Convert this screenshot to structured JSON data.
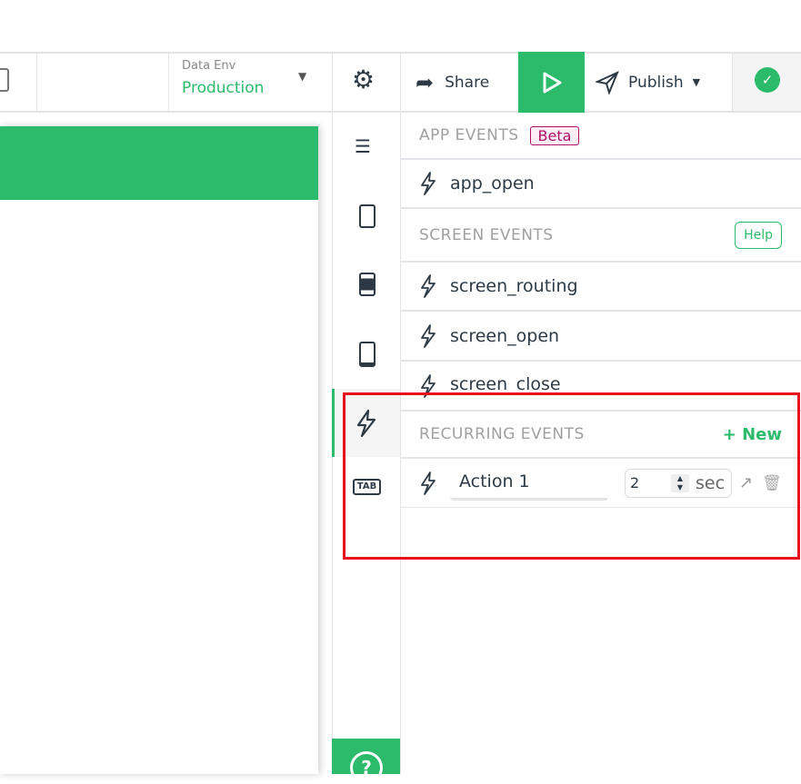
{
  "toolbar": {
    "data_env_label": "Data Env",
    "data_env_value": "Production",
    "share": "Share",
    "publish": "Publish"
  },
  "panel": {
    "app_events": {
      "title": "APP EVENTS",
      "badge": "Beta",
      "items": [
        "app_open"
      ]
    },
    "screen_events": {
      "title": "SCREEN EVENTS",
      "help": "Help",
      "items": [
        "screen_routing",
        "screen_open",
        "screen_close"
      ]
    },
    "recurring_events": {
      "title": "RECURRING EVENTS",
      "new": "+ New",
      "action_name": "Action 1",
      "interval": "2",
      "unit": "sec"
    }
  },
  "rail": {
    "tab_label": "TAB",
    "help": "?"
  },
  "colors": {
    "accent": "#2bbb6b",
    "beta": "#b0106a",
    "highlight": "#e8101c"
  }
}
